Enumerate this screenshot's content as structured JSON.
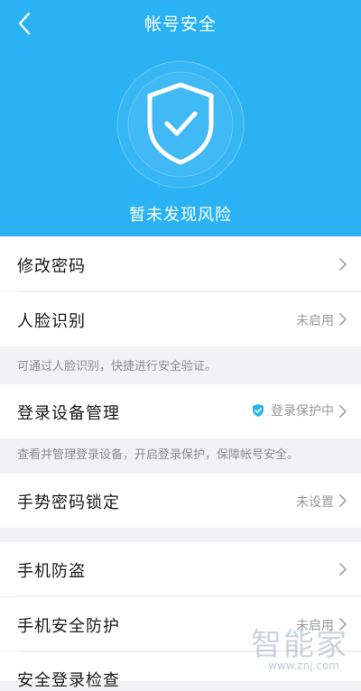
{
  "header": {
    "title": "帐号安全",
    "status": "暂未发现风险",
    "back_icon": "chevron-left-icon",
    "shield_icon": "shield-check-icon",
    "bg_color": "#2ab2f4"
  },
  "rows": {
    "change_password": {
      "label": "修改密码"
    },
    "face_recognition": {
      "label": "人脸识别",
      "value": "未启用"
    },
    "device_management": {
      "label": "登录设备管理",
      "value": "登录保护中"
    },
    "gesture_lock": {
      "label": "手势密码锁定",
      "value": "未设置"
    },
    "anti_theft": {
      "label": "手机防盗"
    },
    "phone_protection": {
      "label": "手机安全防护",
      "value": "未启用"
    },
    "security_check": {
      "label": "安全登录检查"
    }
  },
  "hints": {
    "face": "可通过人脸识别，快捷进行安全验证。",
    "device": "查看并管理登录设备，开启登录保护，保障帐号安全。"
  },
  "watermark": {
    "text": "智能家",
    "url": "www.znj.com"
  }
}
